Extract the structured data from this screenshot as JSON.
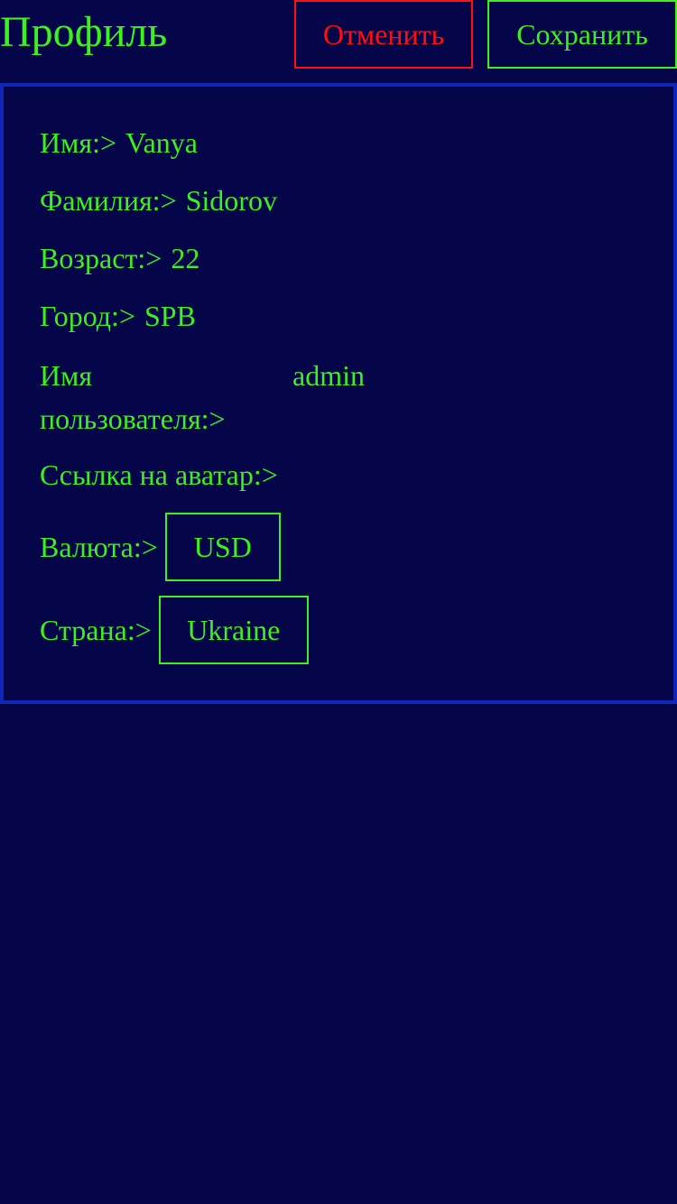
{
  "header": {
    "title": "Профиль",
    "cancel_label": "Отменить",
    "save_label": "Сохранить"
  },
  "profile": {
    "first_name": {
      "label": "Имя:>",
      "value": "Vanya"
    },
    "last_name": {
      "label": "Фамилия:>",
      "value": "Sidorov"
    },
    "age": {
      "label": "Возраст:>",
      "value": "22"
    },
    "city": {
      "label": "Город:>",
      "value": "SPB"
    },
    "username": {
      "label_line1": "Имя",
      "label_line2": "пользователя:>",
      "value": "admin"
    },
    "avatar": {
      "label": "Ссылка на аватар:>",
      "value": ""
    },
    "currency": {
      "label": "Валюта:>",
      "value": "USD"
    },
    "country": {
      "label": "Страна:>",
      "value": "Ukraine"
    }
  },
  "colors": {
    "background": "#050549",
    "text": "#3df01e",
    "cancel": "#ff1010",
    "card_border": "#1026b8"
  }
}
